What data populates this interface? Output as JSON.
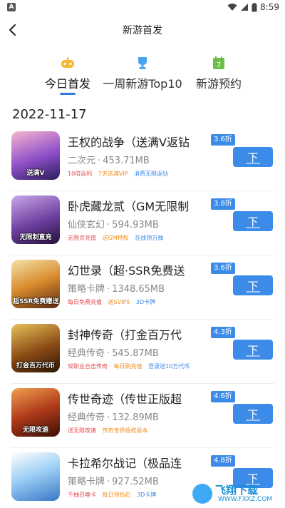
{
  "status_bar": {
    "time": "8:59",
    "app_icon_letter": "A"
  },
  "header": {
    "title": "新游首发",
    "back_icon": "back-arrow-icon"
  },
  "tabs": [
    {
      "label": "今日首发",
      "icon": "gamepad-icon",
      "icon_color": "#f5b731",
      "active": true
    },
    {
      "label": "一周新游Top10",
      "icon": "trophy-icon",
      "icon_color": "#4aa3f0",
      "active": false
    },
    {
      "label": "新游预约",
      "icon": "calendar-icon",
      "icon_color": "#6cc04a",
      "active": false
    }
  ],
  "date": "2022-11-17",
  "colors": {
    "accent": "#3d8be8",
    "tag_red": "#e5484d",
    "tag_orange": "#f08c1c",
    "tag_blue": "#3d8be8"
  },
  "games": [
    {
      "name": "王权的战争（送满V返钻",
      "discount": "3.6折",
      "category": "二次元",
      "size": "453.71MB",
      "cover_text": "送满V",
      "tags": [
        {
          "text": "10倍返利",
          "color": "red"
        },
        {
          "text": "7天送满VIP",
          "color": "orange"
        },
        {
          "text": "消费无限返钻",
          "color": "blue"
        }
      ]
    },
    {
      "name": "卧虎藏龙贰（GM无限制",
      "discount": "3.8折",
      "category": "仙侠玄幻",
      "size": "594.93MB",
      "cover_text": "无限制直充",
      "tags": [
        {
          "text": "无限点充值",
          "color": "red"
        },
        {
          "text": "送GM特权",
          "color": "orange"
        },
        {
          "text": "在线领万抽",
          "color": "blue"
        }
      ]
    },
    {
      "name": "幻世录（超·SSR免费送",
      "discount": "3.6折",
      "category": "策略卡牌",
      "size": "1348.65MB",
      "cover_text": "超SSR免费赠送",
      "tags": [
        {
          "text": "每日免费充值",
          "color": "red"
        },
        {
          "text": "送SVIP5",
          "color": "orange"
        },
        {
          "text": "3D卡牌",
          "color": "blue"
        }
      ]
    },
    {
      "name": "封神传奇（打金百万代",
      "discount": "4.3折",
      "category": "经典传奇",
      "size": "545.87MB",
      "cover_text": "打金百万代币",
      "tags": [
        {
          "text": "双职业合击传奇",
          "color": "red"
        },
        {
          "text": "每日刷充值",
          "color": "orange"
        },
        {
          "text": "登录送10万代币",
          "color": "blue"
        }
      ]
    },
    {
      "name": "传世奇迹（传世正版超",
      "discount": "4.6折",
      "category": "经典传奇",
      "size": "132.89MB",
      "cover_text": "无限攻速",
      "tags": [
        {
          "text": "送无限攻速",
          "color": "red"
        },
        {
          "text": "传奇世界授权版本",
          "color": "orange"
        }
      ]
    },
    {
      "name": "卡拉希尔战记（极品连",
      "discount": "4.8折",
      "category": "策略卡牌",
      "size": "927.52MB",
      "cover_text": "",
      "tags": [
        {
          "text": "千抽召唤卡",
          "color": "red"
        },
        {
          "text": "每日领钻石",
          "color": "orange"
        },
        {
          "text": "3D卡牌",
          "color": "blue"
        }
      ]
    }
  ],
  "download_label": "下",
  "watermark": {
    "main": "飞翔下载",
    "sub": "WWW.FXXZ.COM"
  }
}
